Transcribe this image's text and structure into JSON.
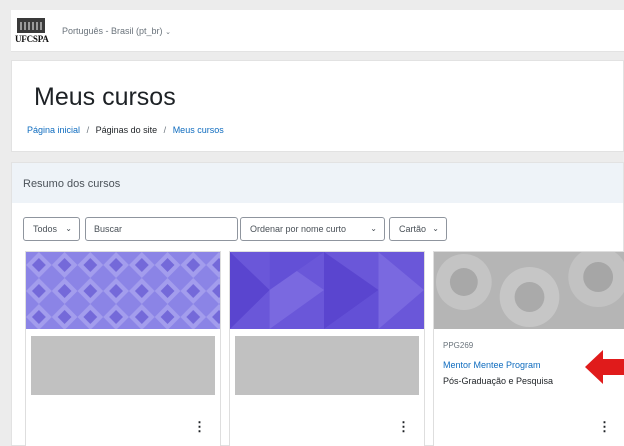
{
  "navbar": {
    "logo_text": "UFCSPA",
    "language": "Português - Brasil (pt_br)",
    "language_icon": "chevron-down-icon"
  },
  "header": {
    "title": "Meus cursos",
    "breadcrumb": [
      "Página inicial",
      "Páginas do site",
      "Meus cursos"
    ],
    "breadcrumb_separator": "/"
  },
  "block": {
    "title": "Resumo dos cursos",
    "filter": {
      "label": "Todos",
      "icon": "chevron-down-icon"
    },
    "search": {
      "placeholder": "Buscar"
    },
    "sort": {
      "label": "Ordenar por nome curto",
      "icon": "chevron-down-icon"
    },
    "view": {
      "label": "Cartão",
      "icon": "chevron-down-icon"
    },
    "menu_glyph": "⋮"
  },
  "courses": [
    {
      "category": "",
      "name": "",
      "subtitle": "",
      "image_color": "#8b84e6"
    },
    {
      "category": "",
      "name": "",
      "subtitle": "",
      "image_color": "#6a57d9"
    },
    {
      "category": "PPG269",
      "name": "Mentor Mentee Program",
      "subtitle": "Pós-Graduação e Pesquisa",
      "image_color": "#b5b5b5"
    }
  ],
  "colors": {
    "link": "#0f6cbf",
    "header_bg": "#eef3f8",
    "annotation_arrow": "#e01b1b"
  }
}
